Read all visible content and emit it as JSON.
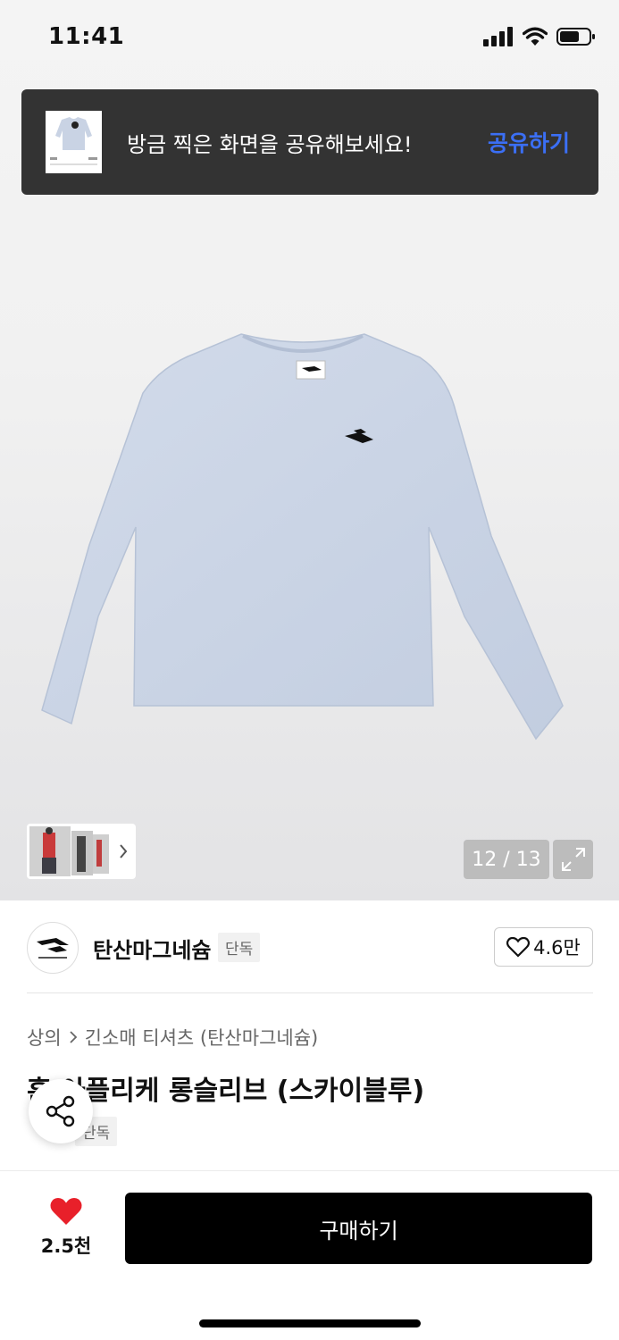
{
  "status_bar": {
    "time": "11:41"
  },
  "toast": {
    "message": "방금 찍은 화면을 공유해보세요!",
    "action_label": "공유하기"
  },
  "gallery": {
    "page_counter": "12 / 13"
  },
  "brand": {
    "name": "탄산마그네슘",
    "badge": "단독",
    "like_count": "4.6만"
  },
  "breadcrumb": {
    "category": "상의",
    "subcategory": "긴소매 티셔츠 (탄산마그네슘)"
  },
  "product": {
    "title": "훈 아플리케 롱슬리브 (스카이블루)",
    "badge": "단독"
  },
  "bottom_bar": {
    "wish_count": "2.5천",
    "buy_label": "구매하기"
  },
  "colors": {
    "toast_bg": "#333333",
    "toast_action": "#3b6ff5",
    "wish_heart": "#e8202a",
    "buy_button_bg": "#000000",
    "shirt": "#c9d3e4"
  }
}
